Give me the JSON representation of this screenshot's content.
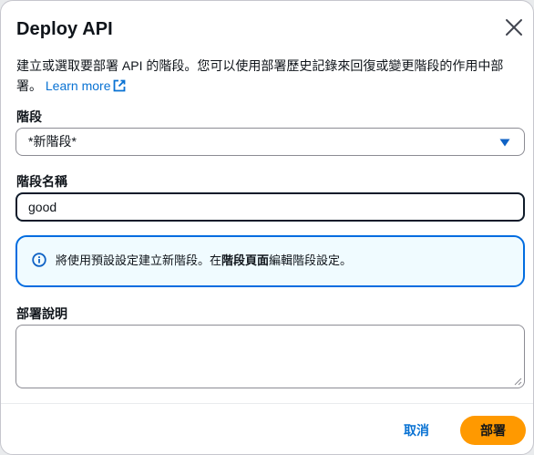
{
  "modal": {
    "title": "Deploy API",
    "description": "建立或選取要部署 API 的階段。您可以使用部署歷史記錄來回復或變更階段的作用中部署。",
    "learn_more": "Learn more"
  },
  "stage": {
    "label": "階段",
    "selected": "*新階段*"
  },
  "stage_name": {
    "label": "階段名稱",
    "value": "good"
  },
  "info": {
    "text_before": "將使用預設設定建立新階段。在",
    "text_bold": "階段頁面",
    "text_after": "編輯階段設定。"
  },
  "deployment_description": {
    "label": "部署說明",
    "value": ""
  },
  "footer": {
    "cancel_label": "取消",
    "deploy_label": "部署"
  },
  "colors": {
    "accent": "#0972d3",
    "primary_button": "#ff9900",
    "info_border": "#006ce0",
    "info_background": "#f0fbff"
  },
  "icons": {
    "close": "close-icon",
    "external_link": "external-link-icon",
    "caret": "caret-down-icon",
    "info": "info-icon",
    "resize": "resize-handle-icon"
  }
}
